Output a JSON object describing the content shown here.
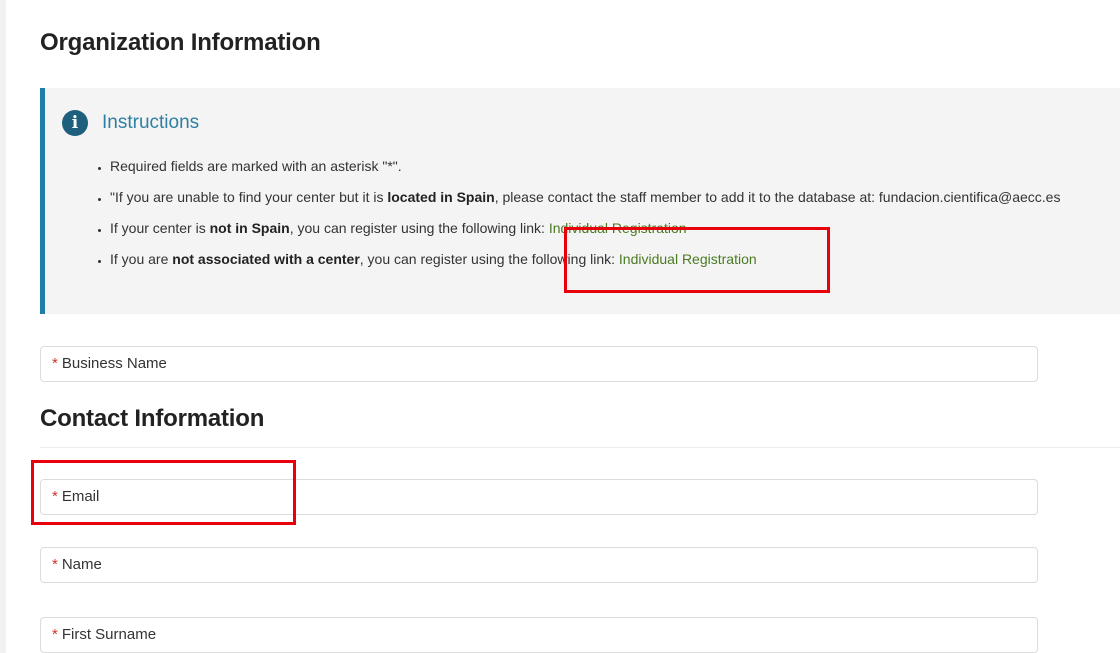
{
  "org_section": {
    "title": "Organization Information"
  },
  "instructions": {
    "title": "Instructions",
    "icon": "info-icon",
    "items": [
      {
        "text": "Required fields are marked with an asterisk \"*\"."
      },
      {
        "pre": "\"If you are unable to find your center but it is ",
        "bold": "located in Spain",
        "post": ", please contact the staff member to add it to the database at: fundacion.cientifica@aecc.es"
      },
      {
        "pre": "If your center is ",
        "bold": "not in Spain",
        "post": ", you can register using the following link: ",
        "link": "Individual Registration"
      },
      {
        "pre": "If you are ",
        "bold": "not associated with a center",
        "post": ", you can register using the following link: ",
        "link": "Individual Registration"
      }
    ]
  },
  "fields": {
    "business_name": {
      "asterisk": "*",
      "label": "Business Name"
    },
    "email": {
      "asterisk": "*",
      "label": "Email"
    },
    "name": {
      "asterisk": "*",
      "label": "Name"
    },
    "first_surname": {
      "asterisk": "*",
      "label": "First Surname"
    }
  },
  "contact_section": {
    "title": "Contact Information"
  },
  "colors": {
    "accent_bar": "#1f7ea6",
    "link": "#4a7a22",
    "required": "#d0342c",
    "highlight_box": "#e8000b"
  }
}
